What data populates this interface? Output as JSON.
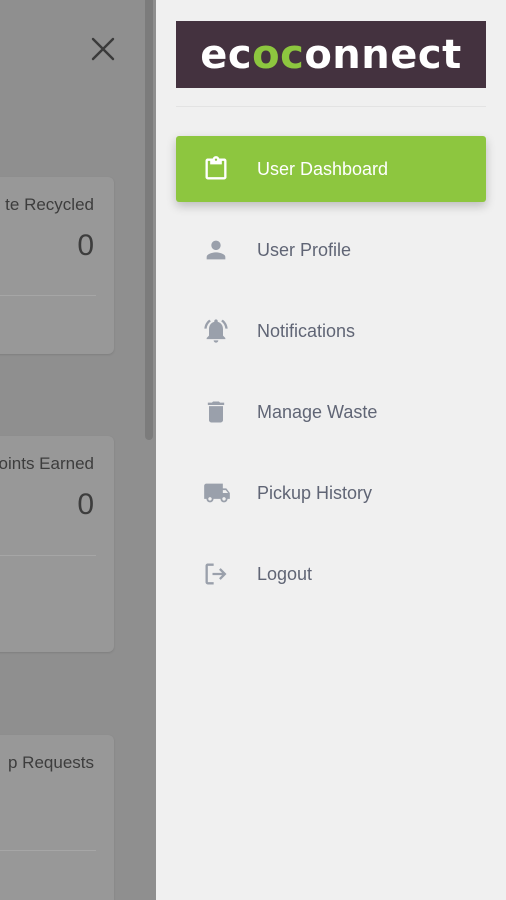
{
  "colors": {
    "accent": "#8dc63f",
    "logo_bg": "#44323f",
    "menu_text": "#606575",
    "icon": "#9aa0ab"
  },
  "background": {
    "cards": [
      {
        "label": "te Recycled",
        "value": "0"
      },
      {
        "label": "oints Earned",
        "value": "0"
      },
      {
        "label": "p Requests",
        "value": ""
      }
    ]
  },
  "drawer": {
    "logo": {
      "part1": "ec",
      "accent": "oc",
      "part2": "onnect"
    },
    "nav": [
      {
        "label": "User Dashboard",
        "icon": "clipboard-icon",
        "active": true
      },
      {
        "label": "User Profile",
        "icon": "person-icon",
        "active": false
      },
      {
        "label": "Notifications",
        "icon": "bell-icon",
        "active": false
      },
      {
        "label": "Manage Waste",
        "icon": "trash-icon",
        "active": false
      },
      {
        "label": "Pickup History",
        "icon": "truck-icon",
        "active": false
      },
      {
        "label": "Logout",
        "icon": "logout-icon",
        "active": false
      }
    ]
  }
}
